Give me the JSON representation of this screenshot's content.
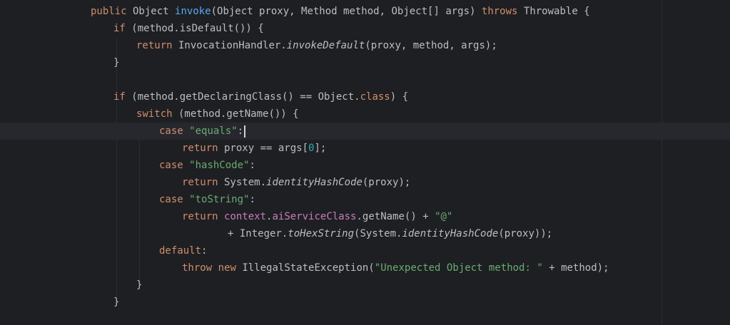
{
  "editor": {
    "language": "java",
    "current_line_index": 7,
    "lines": [
      {
        "indent": 4,
        "tokens": [
          {
            "t": "public",
            "c": "kw"
          },
          {
            "t": " Object "
          },
          {
            "t": "invoke",
            "c": "fn"
          },
          {
            "t": "(Object proxy, Method method, Object[] args) "
          },
          {
            "t": "throws",
            "c": "kw"
          },
          {
            "t": " Throwable {"
          }
        ]
      },
      {
        "indent": 8,
        "tokens": [
          {
            "t": "if",
            "c": "kw"
          },
          {
            "t": " (method.isDefault()) {"
          }
        ]
      },
      {
        "indent": 12,
        "tokens": [
          {
            "t": "return",
            "c": "kw"
          },
          {
            "t": " InvocationHandler."
          },
          {
            "t": "invokeDefault",
            "c": "it"
          },
          {
            "t": "(proxy, method, args);"
          }
        ]
      },
      {
        "indent": 8,
        "tokens": [
          {
            "t": "}"
          }
        ]
      },
      {
        "indent": 0,
        "tokens": []
      },
      {
        "indent": 8,
        "tokens": [
          {
            "t": "if",
            "c": "kw"
          },
          {
            "t": " (method.getDeclaringClass() == Object."
          },
          {
            "t": "class",
            "c": "kw"
          },
          {
            "t": ") {"
          }
        ]
      },
      {
        "indent": 12,
        "tokens": [
          {
            "t": "switch",
            "c": "kw"
          },
          {
            "t": " (method.getName()) {"
          }
        ]
      },
      {
        "indent": 16,
        "caret": true,
        "tokens": [
          {
            "t": "case",
            "c": "kw"
          },
          {
            "t": " "
          },
          {
            "t": "\"equals\"",
            "c": "st"
          },
          {
            "t": ":"
          }
        ]
      },
      {
        "indent": 20,
        "tokens": [
          {
            "t": "return",
            "c": "kw"
          },
          {
            "t": " proxy == args["
          },
          {
            "t": "0",
            "c": "nm"
          },
          {
            "t": "];"
          }
        ]
      },
      {
        "indent": 16,
        "tokens": [
          {
            "t": "case",
            "c": "kw"
          },
          {
            "t": " "
          },
          {
            "t": "\"hashCode\"",
            "c": "st"
          },
          {
            "t": ":"
          }
        ]
      },
      {
        "indent": 20,
        "tokens": [
          {
            "t": "return",
            "c": "kw"
          },
          {
            "t": " System."
          },
          {
            "t": "identityHashCode",
            "c": "it"
          },
          {
            "t": "(proxy);"
          }
        ]
      },
      {
        "indent": 16,
        "tokens": [
          {
            "t": "case",
            "c": "kw"
          },
          {
            "t": " "
          },
          {
            "t": "\"toString\"",
            "c": "st"
          },
          {
            "t": ":"
          }
        ]
      },
      {
        "indent": 20,
        "tokens": [
          {
            "t": "return",
            "c": "kw"
          },
          {
            "t": " "
          },
          {
            "t": "context",
            "c": "fd"
          },
          {
            "t": "."
          },
          {
            "t": "aiServiceClass",
            "c": "fd"
          },
          {
            "t": ".getName() + "
          },
          {
            "t": "\"@\"",
            "c": "st"
          }
        ]
      },
      {
        "indent": 28,
        "tokens": [
          {
            "t": "+ Integer."
          },
          {
            "t": "toHexString",
            "c": "it"
          },
          {
            "t": "(System."
          },
          {
            "t": "identityHashCode",
            "c": "it"
          },
          {
            "t": "(proxy));"
          }
        ]
      },
      {
        "indent": 16,
        "tokens": [
          {
            "t": "default",
            "c": "kw"
          },
          {
            "t": ":"
          }
        ]
      },
      {
        "indent": 20,
        "tokens": [
          {
            "t": "throw",
            "c": "kw"
          },
          {
            "t": " "
          },
          {
            "t": "new",
            "c": "kw"
          },
          {
            "t": " IllegalStateException("
          },
          {
            "t": "\"Unexpected Object method: \"",
            "c": "st"
          },
          {
            "t": " + method);"
          }
        ]
      },
      {
        "indent": 12,
        "tokens": [
          {
            "t": "}"
          }
        ]
      },
      {
        "indent": 8,
        "tokens": [
          {
            "t": "}"
          }
        ]
      }
    ]
  },
  "colors": {
    "background": "#1e1f22",
    "current_line": "#26282e",
    "keyword": "#cf8e6d",
    "method_decl": "#56a8f5",
    "string": "#6aab73",
    "number": "#2aacb8",
    "field": "#c77dbb",
    "default_text": "#bcbec4"
  }
}
